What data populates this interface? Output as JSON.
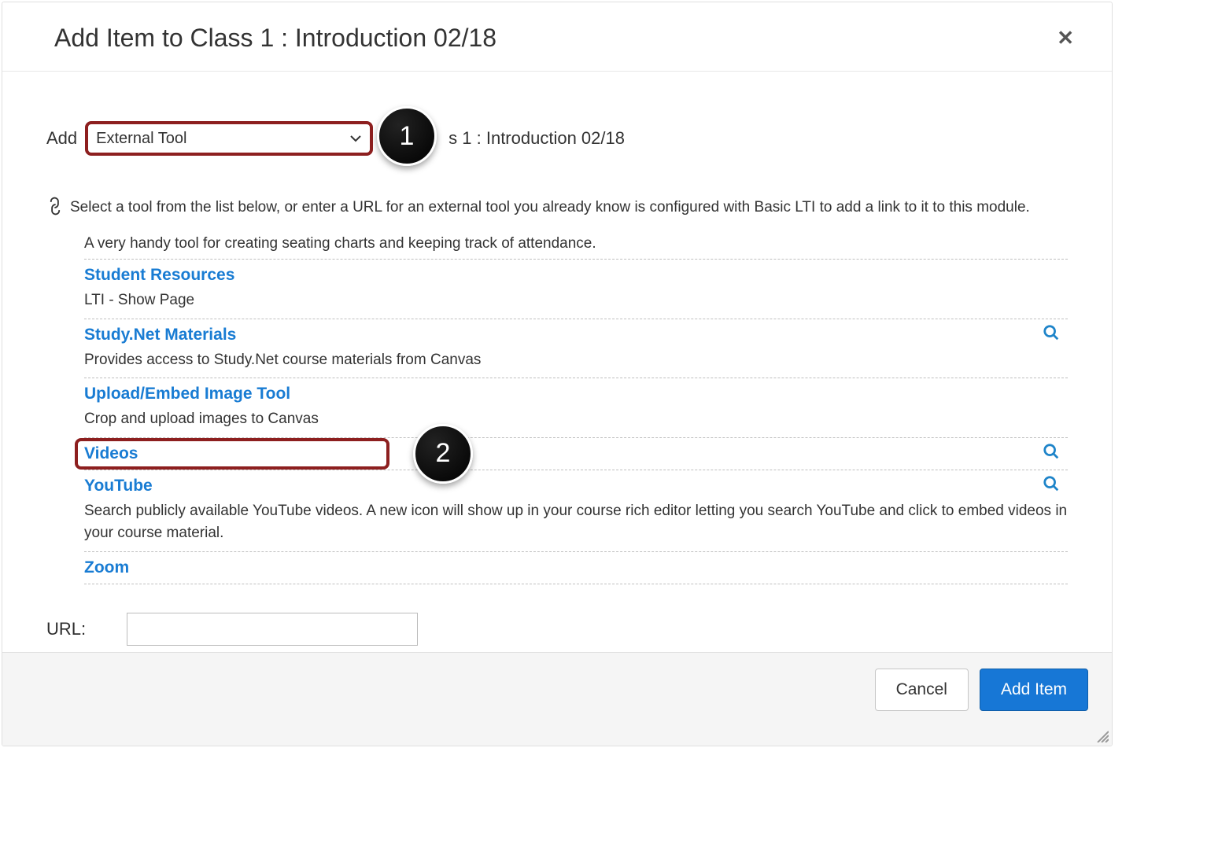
{
  "colors": {
    "link": "#197cd3",
    "highlight_border": "#8d1f1f",
    "primary_button": "#1777d6"
  },
  "header": {
    "title": "Add Item to Class 1 : Introduction 02/18",
    "close_glyph": "✕"
  },
  "add_row": {
    "label": "Add",
    "dropdown_value": "External Tool",
    "after_text": "s 1 : Introduction 02/18"
  },
  "callouts": {
    "one": "1",
    "two": "2"
  },
  "instruction": "Select a tool from the list below, or enter a URL for an external tool you already know is configured with Basic LTI to add a link to it to this module.",
  "tool_first_desc": "A very handy tool for creating seating charts and keeping track of attendance.",
  "tools": [
    {
      "name": "Student Resources",
      "desc": "LTI - Show Page",
      "search": false
    },
    {
      "name": "Study.Net Materials",
      "desc": "Provides access to Study.Net course materials from Canvas",
      "search": true
    },
    {
      "name": "Upload/Embed Image Tool",
      "desc": "Crop and upload images to Canvas",
      "search": false
    },
    {
      "name": "Videos",
      "desc": "",
      "search": true,
      "highlighted": true
    },
    {
      "name": "YouTube",
      "desc": "Search publicly available YouTube videos. A new icon will show up in your course rich editor letting you search YouTube and click to embed videos in your course material.",
      "search": true
    },
    {
      "name": "Zoom",
      "desc": "",
      "search": false
    }
  ],
  "url_row": {
    "label": "URL:",
    "value": ""
  },
  "footer": {
    "cancel": "Cancel",
    "add_item": "Add Item"
  }
}
